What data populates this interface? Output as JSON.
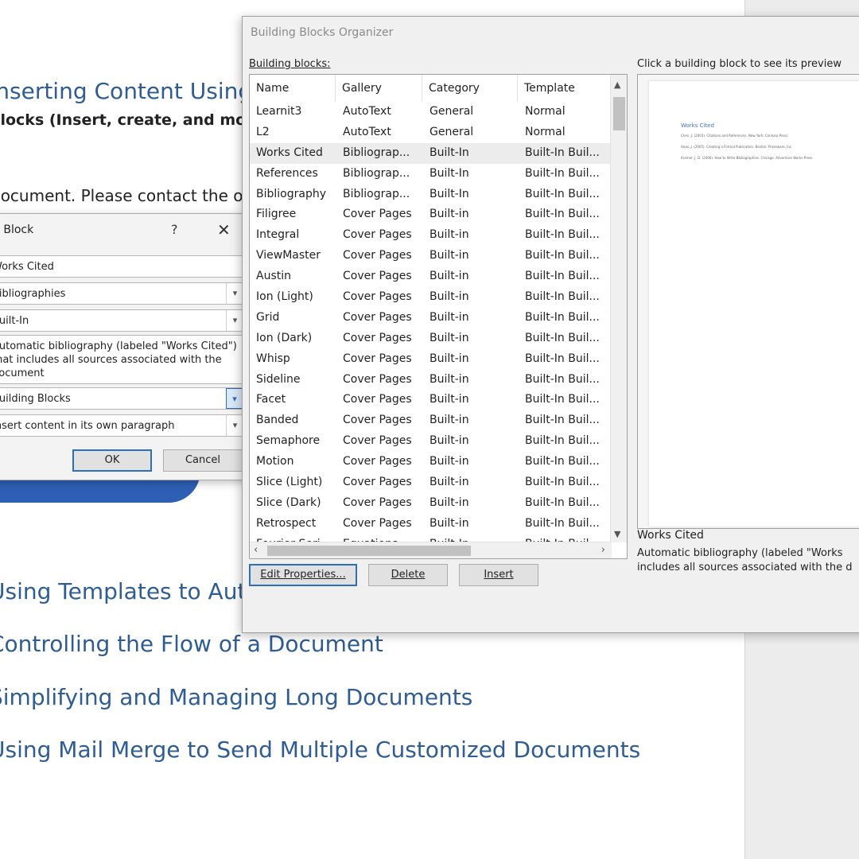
{
  "document": {
    "heading": "Inserting Content Using F",
    "subheading": "Blocks (Insert, create, and modif",
    "paragraph": "document. Please contact the ov",
    "outline": [
      "Using Templates to Auto",
      "Controlling the Flow of a Document",
      "Simplifying and Managing Long Documents",
      "Using Mail Merge to Send Multiple Customized Documents"
    ]
  },
  "create_dialog": {
    "title": "g Block",
    "help_glyph": "?",
    "close_glyph": "✕",
    "name_value": "Works Cited",
    "gallery_value": "Bibliographies",
    "category_value": "Built-In",
    "description_value": "Automatic bibliography (labeled \"Works Cited\") that includes all sources associated with the document",
    "save_in_value": "Building Blocks",
    "options_value": "Insert content in its own paragraph",
    "ok_label": "OK",
    "cancel_label": "Cancel"
  },
  "organizer": {
    "title": "Building Blocks Organizer",
    "list_label": "Building blocks:",
    "preview_label": "Click a building block to see its preview",
    "columns": [
      "Name",
      "Gallery",
      "Category",
      "Template"
    ],
    "rows": [
      [
        "Learnit3",
        "AutoText",
        "General",
        "Normal"
      ],
      [
        "L2",
        "AutoText",
        "General",
        "Normal"
      ],
      [
        "Works Cited",
        "Bibliograp...",
        "Built-In",
        "Built-In Buil..."
      ],
      [
        "References",
        "Bibliograp...",
        "Built-In",
        "Built-In Buil..."
      ],
      [
        "Bibliography",
        "Bibliograp...",
        "Built-In",
        "Built-In Buil..."
      ],
      [
        "Filigree",
        "Cover Pages",
        "Built-in",
        "Built-In Buil..."
      ],
      [
        "Integral",
        "Cover Pages",
        "Built-in",
        "Built-In Buil..."
      ],
      [
        "ViewMaster",
        "Cover Pages",
        "Built-in",
        "Built-In Buil..."
      ],
      [
        "Austin",
        "Cover Pages",
        "Built-in",
        "Built-In Buil..."
      ],
      [
        "Ion (Light)",
        "Cover Pages",
        "Built-in",
        "Built-In Buil..."
      ],
      [
        "Grid",
        "Cover Pages",
        "Built-in",
        "Built-In Buil..."
      ],
      [
        "Ion (Dark)",
        "Cover Pages",
        "Built-in",
        "Built-In Buil..."
      ],
      [
        "Whisp",
        "Cover Pages",
        "Built-in",
        "Built-In Buil..."
      ],
      [
        "Sideline",
        "Cover Pages",
        "Built-in",
        "Built-In Buil..."
      ],
      [
        "Facet",
        "Cover Pages",
        "Built-in",
        "Built-In Buil..."
      ],
      [
        "Banded",
        "Cover Pages",
        "Built-in",
        "Built-In Buil..."
      ],
      [
        "Semaphore",
        "Cover Pages",
        "Built-in",
        "Built-In Buil..."
      ],
      [
        "Motion",
        "Cover Pages",
        "Built-in",
        "Built-In Buil..."
      ],
      [
        "Slice (Light)",
        "Cover Pages",
        "Built-in",
        "Built-In Buil..."
      ],
      [
        "Slice (Dark)",
        "Cover Pages",
        "Built-in",
        "Built-In Buil..."
      ],
      [
        "Retrospect",
        "Cover Pages",
        "Built-in",
        "Built-In Buil..."
      ],
      [
        "Fourier Seri...",
        "Equations",
        "Built-In",
        "Built-In Buil..."
      ]
    ],
    "selected_row": 2,
    "preview": {
      "title": "Works Cited",
      "lines": [
        "Chen, J. (2003). Citations and References. New York: Contoso Press.",
        "Haas, J. (2005). Creating a Formal Publication. Boston: Proseware, Inc.",
        "Kramer, J. D. (2006). How to Write Bibliographies. Chicago: Adventure Works Press."
      ]
    },
    "selected_name": "Works Cited",
    "selected_description": "Automatic bibliography (labeled \"Works\nincludes all sources associated with the d",
    "buttons": {
      "edit_properties": "Edit Properties...",
      "delete": "Delete",
      "insert": "Insert"
    }
  }
}
